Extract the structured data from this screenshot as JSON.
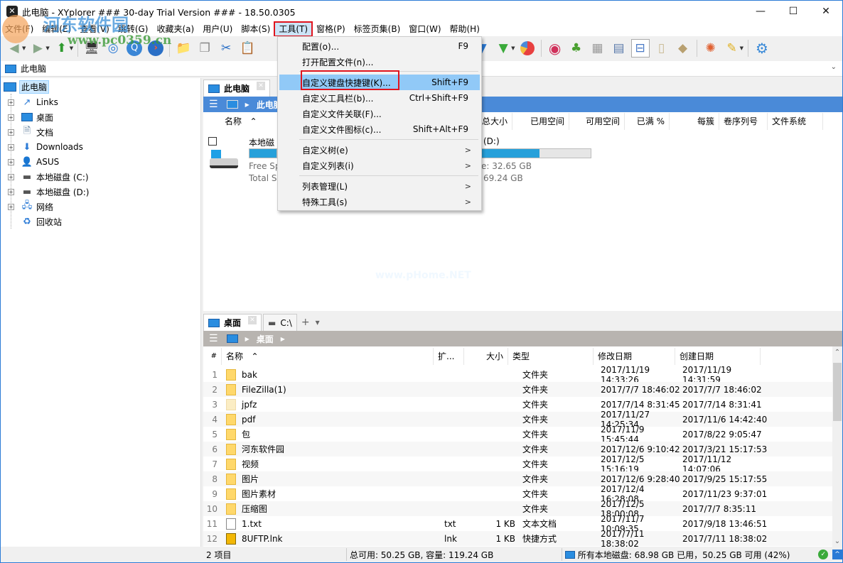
{
  "window": {
    "title": "此电脑 - XYplorer ### 30-day Trial Version ### - 18.50.0305",
    "controls": {
      "minimize": "—",
      "maximize": "☐",
      "close": "✕"
    }
  },
  "watermark": {
    "text1": "河东软件园",
    "text2": "www.pc0359.cn",
    "center": "www.pHome.NET"
  },
  "menubar": {
    "items": [
      "文件(F)",
      "编辑(E)",
      "查看(V)",
      "跳转(G)",
      "收藏夹(a)",
      "用户(U)",
      "脚本(S)",
      "工具(T)",
      "窗格(P)",
      "标签页集(B)",
      "窗口(W)",
      "帮助(H)"
    ],
    "active_index": 7
  },
  "toolbar": {
    "icons": [
      "back-icon",
      "forward-icon",
      "up-icon",
      "computer-icon",
      "target-icon",
      "search-icon",
      "goto-icon",
      "new-folder-icon",
      "copy-icon",
      "cut-icon",
      "paste-icon",
      "filter-blue-icon",
      "filter-green-icon",
      "pie-chart-icon",
      "spiral-icon",
      "tree-icon",
      "panes-icon",
      "grid-icon",
      "dual-pane-icon",
      "single-pane-icon",
      "tag-icon",
      "pinwheel-icon",
      "brush-icon",
      "gear-icon"
    ]
  },
  "address": {
    "value": "此电脑"
  },
  "tools_menu": {
    "items": [
      {
        "label": "配置(o)...",
        "shortcut": "F9"
      },
      {
        "label": "打开配置文件(n)...",
        "shortcut": ""
      },
      {
        "label": "自定义键盘快捷键(K)...",
        "shortcut": "Shift+F9",
        "highlighted": true
      },
      {
        "label": "自定义工具栏(b)...",
        "shortcut": "Ctrl+Shift+F9"
      },
      {
        "label": "自定义文件关联(F)...",
        "shortcut": ""
      },
      {
        "label": "自定义文件图标(c)...",
        "shortcut": "Shift+Alt+F9"
      },
      {
        "label": "自定义树(e)",
        "submenu": ">"
      },
      {
        "label": "自定义列表(i)",
        "submenu": ">"
      },
      {
        "label": "列表管理(L)",
        "submenu": ">"
      },
      {
        "label": "特殊工具(s)",
        "submenu": ">"
      }
    ]
  },
  "tree": {
    "root": "此电脑",
    "items": [
      {
        "label": "Links",
        "icon": "links-icon"
      },
      {
        "label": "桌面",
        "icon": "desktop-icon"
      },
      {
        "label": "文档",
        "icon": "documents-icon"
      },
      {
        "label": "Downloads",
        "icon": "downloads-icon"
      },
      {
        "label": "ASUS",
        "icon": "user-icon"
      },
      {
        "label": "本地磁盘 (C:)",
        "icon": "drive-c-icon"
      },
      {
        "label": "本地磁盘 (D:)",
        "icon": "drive-d-icon"
      },
      {
        "label": "网络",
        "icon": "network-icon"
      },
      {
        "label": "回收站",
        "icon": "recycle-bin-icon"
      }
    ]
  },
  "pane1": {
    "tab": "此电脑",
    "breadcrumb": "此电脑",
    "columns": [
      "名称",
      "总大小",
      "已用空间",
      "可用空间",
      "已满 %",
      "每簇",
      "卷序列号",
      "文件系统"
    ],
    "drives": [
      {
        "name": "本地磁盘 (C:)",
        "name_visible": "本地磁",
        "free": "Free Sp",
        "total": "Total Si",
        "used_fraction": 0.62
      },
      {
        "name": "本地磁盘 (D:)",
        "name_visible": "(D:)",
        "free": "e: 32.65 GB",
        "total": "69.24 GB",
        "used_fraction": 0.53
      }
    ]
  },
  "pane2": {
    "tabs": [
      {
        "label": "桌面",
        "active": true
      },
      {
        "label": "C:\\",
        "active": false
      }
    ],
    "add_tab": "+",
    "tab_menu": "▾",
    "breadcrumb": "桌面",
    "columns": [
      "#",
      "名称",
      "扩...",
      "大小",
      "类型",
      "修改日期",
      "创建日期"
    ],
    "rows": [
      {
        "n": "1",
        "name": "bak",
        "ext": "",
        "size": "",
        "type": "文件夹",
        "modified": "2017/11/19 14:33:26",
        "created": "2017/11/19 14:31:59",
        "icon": "folder"
      },
      {
        "n": "2",
        "name": "FileZilla(1)",
        "ext": "",
        "size": "",
        "type": "文件夹",
        "modified": "2017/7/7 18:46:02",
        "created": "2017/7/7 18:46:02",
        "icon": "folder"
      },
      {
        "n": "3",
        "name": "jpfz",
        "ext": "",
        "size": "",
        "type": "文件夹",
        "modified": "2017/7/14 8:31:45",
        "created": "2017/7/14 8:31:41",
        "icon": "folder-hidden"
      },
      {
        "n": "4",
        "name": "pdf",
        "ext": "",
        "size": "",
        "type": "文件夹",
        "modified": "2017/11/27 14:25:34",
        "created": "2017/11/6 14:42:40",
        "icon": "folder"
      },
      {
        "n": "5",
        "name": "包",
        "ext": "",
        "size": "",
        "type": "文件夹",
        "modified": "2017/11/9 15:45:44",
        "created": "2017/8/22 9:05:47",
        "icon": "folder"
      },
      {
        "n": "6",
        "name": "河东软件园",
        "ext": "",
        "size": "",
        "type": "文件夹",
        "modified": "2017/12/6 9:10:42",
        "created": "2017/3/21 15:17:53",
        "icon": "folder"
      },
      {
        "n": "7",
        "name": "视频",
        "ext": "",
        "size": "",
        "type": "文件夹",
        "modified": "2017/12/5 15:16:19",
        "created": "2017/11/12 14:07:06",
        "icon": "folder"
      },
      {
        "n": "8",
        "name": "图片",
        "ext": "",
        "size": "",
        "type": "文件夹",
        "modified": "2017/12/6 9:28:40",
        "created": "2017/9/25 15:17:55",
        "icon": "folder"
      },
      {
        "n": "9",
        "name": "图片素材",
        "ext": "",
        "size": "",
        "type": "文件夹",
        "modified": "2017/12/4 16:28:08",
        "created": "2017/11/23 9:37:01",
        "icon": "folder"
      },
      {
        "n": "10",
        "name": "压缩图",
        "ext": "",
        "size": "",
        "type": "文件夹",
        "modified": "2017/12/5 18:00:08",
        "created": "2017/7/7 8:35:11",
        "icon": "folder"
      },
      {
        "n": "11",
        "name": "1.txt",
        "ext": "txt",
        "size": "1 KB",
        "type": "文本文档",
        "modified": "2017/11/7 10:09:35",
        "created": "2017/9/18 13:46:51",
        "icon": "txt"
      },
      {
        "n": "12",
        "name": "8UFTP.lnk",
        "ext": "lnk",
        "size": "1 KB",
        "type": "快捷方式",
        "modified": "2017/7/11 18:38:02",
        "created": "2017/7/11 18:38:02",
        "icon": "lnk"
      }
    ]
  },
  "status": {
    "items": "2 项目",
    "capacity": "总可用: 50.25 GB, 容量: 119.24 GB",
    "disks": "所有本地磁盘: 68.98 GB 已用，50.25 GB 可用 (42%)"
  },
  "colors": {
    "accent": "#4a8ad8",
    "inactive_crumb": "#b8b4b0",
    "highlight": "#91c9f7",
    "red_annotation": "#e0141e"
  }
}
